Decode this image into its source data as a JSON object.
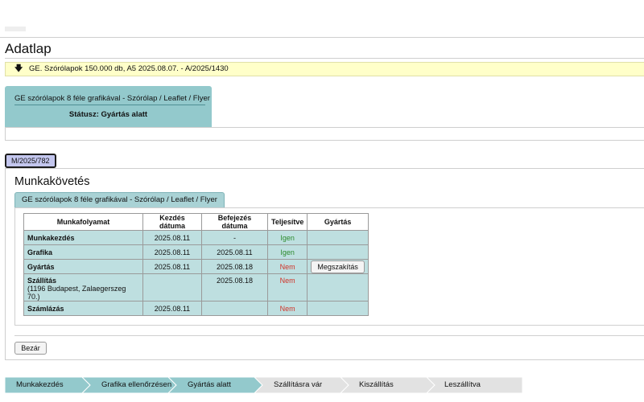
{
  "header": {
    "page_title": "Adatlap",
    "notice_arrow": "🡇",
    "notice_text": "GE. Szórólapok 150.000 db, A5 2025.08.07. - A/2025/1430"
  },
  "job_card": {
    "name": "GE szórólapok 8 féle grafikával - Szórólap / Leaflet / Flyer",
    "status": "Státusz: Gyártás alatt"
  },
  "order_tab": {
    "label": "M/2025/782"
  },
  "section": {
    "title": "Munkakövetés",
    "sub_tab": "GE szórólapok 8 féle grafikával - Szórólap / Leaflet / Flyer"
  },
  "table": {
    "headers": [
      "Munkafolyamat",
      "Kezdés dátuma",
      "Befejezés dátuma",
      "Teljesítve",
      "Gyártás"
    ],
    "rows": [
      {
        "process": "Munkakezdés",
        "sub": "",
        "start": "2025.08.11",
        "end": "-",
        "done": "Igen",
        "done_state": "yes",
        "action": ""
      },
      {
        "process": "Grafika",
        "sub": "",
        "start": "2025.08.11",
        "end": "2025.08.11",
        "done": "Igen",
        "done_state": "yes",
        "action": ""
      },
      {
        "process": "Gyártás",
        "sub": "",
        "start": "2025.08.11",
        "end": "2025.08.18",
        "done": "Nem",
        "done_state": "no",
        "action": "Megszakítás"
      },
      {
        "process": "Szállítás",
        "sub": "(1196 Budapest, Zalaegerszeg 70.)",
        "start": "",
        "end": "2025.08.18",
        "done": "Nem",
        "done_state": "no",
        "action": ""
      },
      {
        "process": "Számlázás",
        "sub": "",
        "start": "2025.08.11",
        "end": "",
        "done": "Nem",
        "done_state": "no",
        "action": ""
      }
    ]
  },
  "buttons": {
    "close": "Bezár"
  },
  "stepper": {
    "steps": [
      {
        "label": "Munkakezdés",
        "state": "done"
      },
      {
        "label": "Grafika ellenőrzésen",
        "state": "done"
      },
      {
        "label": "Gyártás alatt",
        "state": "done"
      },
      {
        "label": "Szállításra vár",
        "state": "pending"
      },
      {
        "label": "Kiszállítás",
        "state": "pending"
      },
      {
        "label": "Leszállítva",
        "state": "pending"
      }
    ],
    "colors": {
      "done": "#93c9cc",
      "pending": "#e2e2e2"
    }
  }
}
